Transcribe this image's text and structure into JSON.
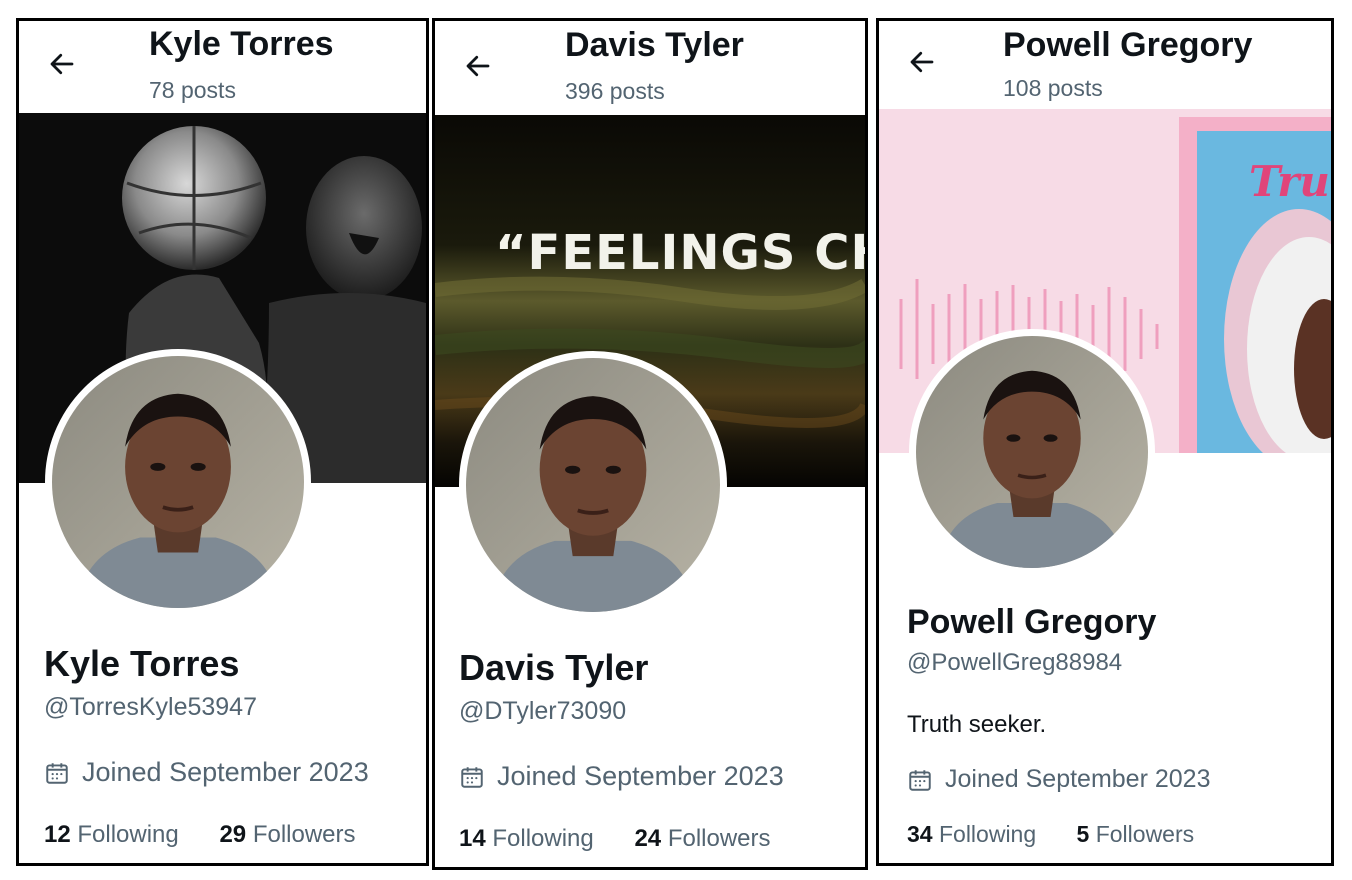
{
  "profiles": [
    {
      "header_name": "Kyle Torres",
      "posts": "78 posts",
      "display_name": "Kyle Torres",
      "handle": "@TorresKyle53947",
      "bio": "",
      "joined": "Joined September 2023",
      "following_count": "12",
      "following_label": "Following",
      "followers_count": "29",
      "followers_label": "Followers",
      "banner_description_icon": "basketball-player-photo"
    },
    {
      "header_name": "Davis Tyler",
      "posts": "396 posts",
      "display_name": "Davis Tyler",
      "handle": "@DTyler73090",
      "bio": "",
      "joined": "Joined September 2023",
      "following_count": "14",
      "following_label": "Following",
      "followers_count": "24",
      "followers_label": "Followers",
      "banner_text": "“FEELINGS CHA"
    },
    {
      "header_name": "Powell Gregory",
      "posts": "108 posts",
      "display_name": "Powell Gregory",
      "handle": "@PowellGreg88984",
      "bio": "Truth seeker.",
      "joined": "Joined September 2023",
      "following_count": "34",
      "following_label": "Following",
      "followers_count": "5",
      "followers_label": "Followers",
      "banner_text": "Tru"
    }
  ],
  "colors": {
    "text_primary": "#0f1419",
    "text_secondary": "#536471",
    "banner_pink": "#f7dbe6",
    "banner_blue": "#6ab8e0"
  }
}
